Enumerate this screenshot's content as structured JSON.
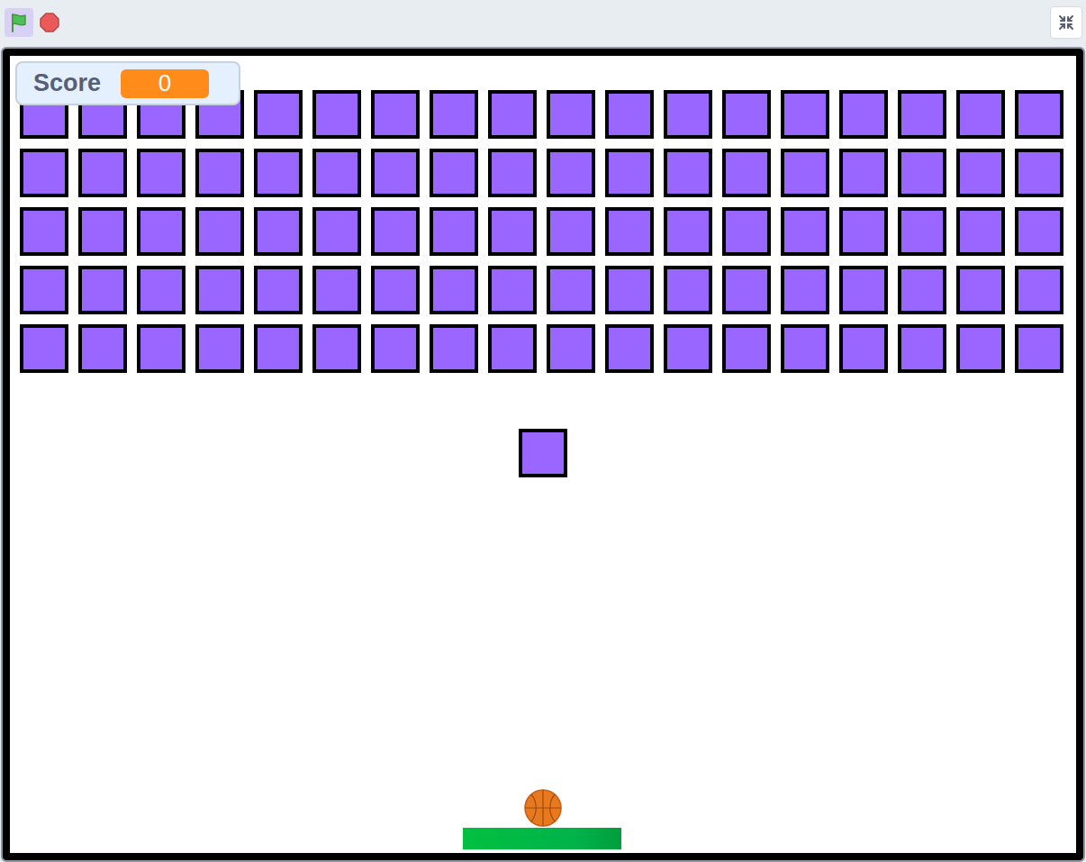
{
  "toolbar": {
    "green_flag": {
      "selected": true
    },
    "stop_sign": {
      "selected": false
    },
    "fullscreen_toggle": {
      "expanded": true
    }
  },
  "score_monitor": {
    "label": "Score",
    "value": "0"
  },
  "brick_wall": {
    "rows": 5,
    "columns": 18
  },
  "loose_brick": {
    "visible": true
  },
  "ball": {
    "visible": true
  },
  "paddle": {
    "visible": true
  }
}
